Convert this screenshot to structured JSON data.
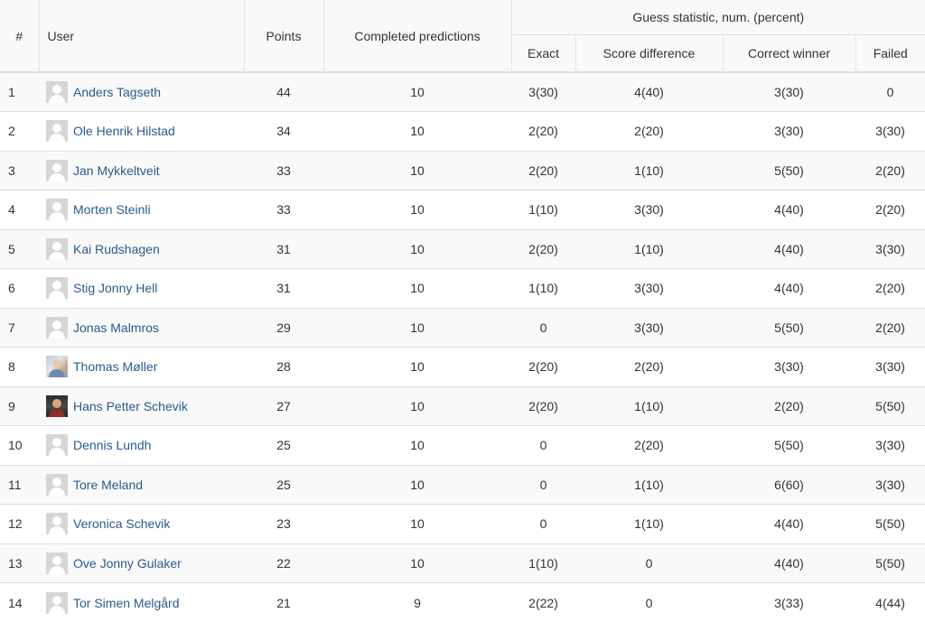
{
  "headers": {
    "rank": "#",
    "user": "User",
    "points": "Points",
    "completed": "Completed predictions",
    "guess_group": "Guess statistic, num. (percent)",
    "exact": "Exact",
    "score_difference": "Score difference",
    "correct_winner": "Correct winner",
    "failed": "Failed"
  },
  "rows": [
    {
      "rank": "1",
      "user": "Anders Tagseth",
      "avatar": "default-avatar-icon",
      "points": "44",
      "completed": "10",
      "exact": "3(30)",
      "diff": "4(40)",
      "winner": "3(30)",
      "failed": "0"
    },
    {
      "rank": "2",
      "user": "Ole Henrik Hilstad",
      "avatar": "default-avatar-icon",
      "points": "34",
      "completed": "10",
      "exact": "2(20)",
      "diff": "2(20)",
      "winner": "3(30)",
      "failed": "3(30)"
    },
    {
      "rank": "3",
      "user": "Jan Mykkeltveit",
      "avatar": "default-avatar-icon",
      "points": "33",
      "completed": "10",
      "exact": "2(20)",
      "diff": "1(10)",
      "winner": "5(50)",
      "failed": "2(20)"
    },
    {
      "rank": "4",
      "user": "Morten Steinli",
      "avatar": "default-avatar-icon",
      "points": "33",
      "completed": "10",
      "exact": "1(10)",
      "diff": "3(30)",
      "winner": "4(40)",
      "failed": "2(20)"
    },
    {
      "rank": "5",
      "user": "Kai Rudshagen",
      "avatar": "default-avatar-icon",
      "points": "31",
      "completed": "10",
      "exact": "2(20)",
      "diff": "1(10)",
      "winner": "4(40)",
      "failed": "3(30)"
    },
    {
      "rank": "6",
      "user": "Stig Jonny Hell",
      "avatar": "default-avatar-icon",
      "points": "31",
      "completed": "10",
      "exact": "1(10)",
      "diff": "3(30)",
      "winner": "4(40)",
      "failed": "2(20)"
    },
    {
      "rank": "7",
      "user": "Jonas Malmros",
      "avatar": "default-avatar-icon",
      "points": "29",
      "completed": "10",
      "exact": "0",
      "diff": "3(30)",
      "winner": "5(50)",
      "failed": "2(20)"
    },
    {
      "rank": "8",
      "user": "Thomas Møller",
      "avatar": "photo-avatar-icon",
      "points": "28",
      "completed": "10",
      "exact": "2(20)",
      "diff": "2(20)",
      "winner": "3(30)",
      "failed": "3(30)"
    },
    {
      "rank": "9",
      "user": "Hans Petter Schevik",
      "avatar": "photo-avatar-icon",
      "points": "27",
      "completed": "10",
      "exact": "2(20)",
      "diff": "1(10)",
      "winner": "2(20)",
      "failed": "5(50)"
    },
    {
      "rank": "10",
      "user": "Dennis Lundh",
      "avatar": "default-avatar-icon",
      "points": "25",
      "completed": "10",
      "exact": "0",
      "diff": "2(20)",
      "winner": "5(50)",
      "failed": "3(30)"
    },
    {
      "rank": "11",
      "user": "Tore Meland",
      "avatar": "default-avatar-icon",
      "points": "25",
      "completed": "10",
      "exact": "0",
      "diff": "1(10)",
      "winner": "6(60)",
      "failed": "3(30)"
    },
    {
      "rank": "12",
      "user": "Veronica Schevik",
      "avatar": "default-avatar-icon",
      "points": "23",
      "completed": "10",
      "exact": "0",
      "diff": "1(10)",
      "winner": "4(40)",
      "failed": "5(50)"
    },
    {
      "rank": "13",
      "user": "Ove Jonny Gulaker",
      "avatar": "default-avatar-icon",
      "points": "22",
      "completed": "10",
      "exact": "1(10)",
      "diff": "0",
      "winner": "4(40)",
      "failed": "5(50)"
    },
    {
      "rank": "14",
      "user": "Tor Simen Melgård",
      "avatar": "default-avatar-icon",
      "points": "21",
      "completed": "9",
      "exact": "2(22)",
      "diff": "0",
      "winner": "3(33)",
      "failed": "4(44)"
    }
  ],
  "colors": {
    "link": "#2a5a8c",
    "stripe": "#f9f9f9",
    "border": "#dddddd"
  }
}
